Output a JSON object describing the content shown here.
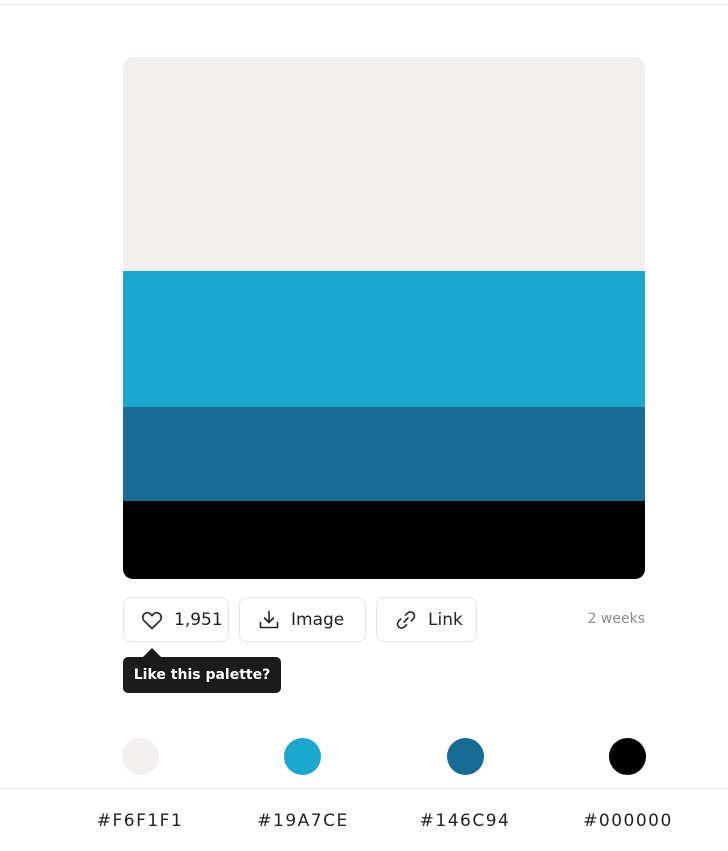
{
  "palette": {
    "colors": [
      {
        "hex": "#F6F1F1",
        "label": "#F6F1F1",
        "swatch": "#F3EFEF"
      },
      {
        "hex": "#19A7CE",
        "label": "#19A7CE",
        "swatch": "#1BA7CE"
      },
      {
        "hex": "#146C94",
        "label": "#146C94",
        "swatch": "#166C94"
      },
      {
        "hex": "#000000",
        "label": "#000000",
        "swatch": "#000000"
      }
    ]
  },
  "actions": {
    "like_count": "1,951",
    "image_label": "Image",
    "link_label": "Link",
    "like_icon": "heart-icon",
    "image_icon": "download-icon",
    "link_icon": "link-icon"
  },
  "meta": {
    "time_ago": "2 weeks"
  },
  "tooltip": {
    "text": "Like this palette?"
  },
  "colors": {
    "border": "#e3e3e3",
    "tooltip_bg": "#1b1b1b",
    "muted_text": "#8a8a8a"
  }
}
